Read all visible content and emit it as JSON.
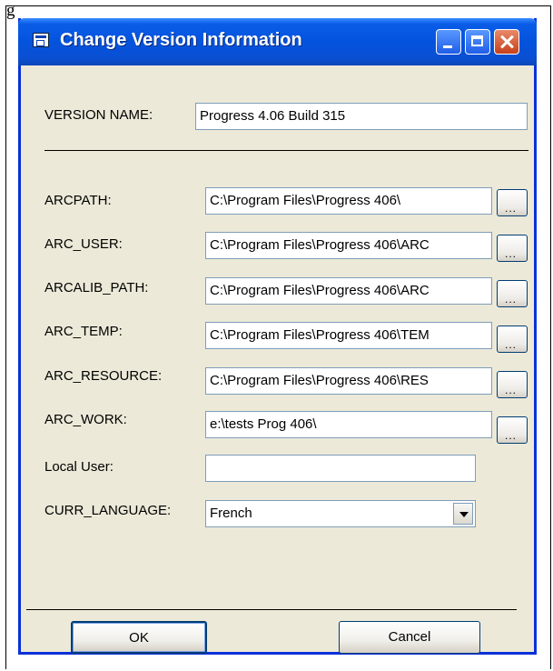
{
  "doc_marker": "g",
  "window": {
    "title": "Change Version Information"
  },
  "version": {
    "label": "VERSION NAME:",
    "value": "Progress 4.06 Build 315"
  },
  "paths": [
    {
      "label": "ARCPATH:",
      "value": "C:\\Program Files\\Progress 406\\",
      "browse": "..."
    },
    {
      "label": "ARC_USER:",
      "value": "C:\\Program Files\\Progress 406\\ARC",
      "browse": "..."
    },
    {
      "label": "ARCALIB_PATH:",
      "value": "C:\\Program Files\\Progress 406\\ARC",
      "browse": "..."
    },
    {
      "label": "ARC_TEMP:",
      "value": "C:\\Program Files\\Progress 406\\TEM",
      "browse": "..."
    },
    {
      "label": "ARC_RESOURCE:",
      "value": "C:\\Program Files\\Progress 406\\RES",
      "browse": "..."
    },
    {
      "label": "ARC_WORK:",
      "value": "e:\\tests Prog 406\\",
      "browse": "..."
    }
  ],
  "local_user": {
    "label": "Local User:",
    "value": ""
  },
  "language": {
    "label": "CURR_LANGUAGE:",
    "selected": "French"
  },
  "buttons": {
    "ok": "OK",
    "cancel": "Cancel"
  }
}
